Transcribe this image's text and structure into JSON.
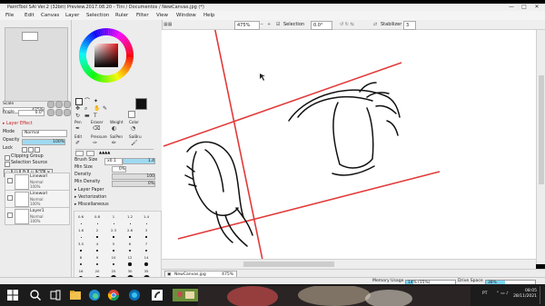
{
  "window": {
    "title": "PaintTool SAI Ver.2 (32bit) Preview.2017.08.20 - Tini / Documentos / NewCanvas.jpg (*)",
    "controls": [
      "—",
      "□",
      "✕"
    ]
  },
  "menu": [
    "File",
    "Edit",
    "Canvas",
    "Layer",
    "Selection",
    "Ruler",
    "Filter",
    "View",
    "Window",
    "Help"
  ],
  "toolbar": {
    "zoom": "475%",
    "selection_label": "Selection",
    "rotation": "0.0°",
    "stabilizer_label": "Stabilizer",
    "stabilizer_value": "3"
  },
  "navigator": {
    "scale_label": "Scale",
    "scale_value": "475%",
    "angle_label": "Angle",
    "angle_value": "0.0°"
  },
  "layer_props": {
    "section": "Layer Effect",
    "mode_label": "Mode",
    "mode_value": "Normal",
    "opacity_label": "Opacity",
    "opacity_value": "100%",
    "lock_label": "Lock",
    "clipping_group": "Clipping Group",
    "selection_source": "Selection Source"
  },
  "layers": [
    {
      "name": "Lineworl",
      "mode": "Normal",
      "opacity": "100%"
    },
    {
      "name": "Lineworl",
      "mode": "Normal",
      "opacity": "100%"
    },
    {
      "name": "Layer1",
      "mode": "Normal",
      "opacity": "100%"
    }
  ],
  "tools": {
    "row1": [
      "Pen",
      "Eraser",
      "Weight",
      "Color"
    ],
    "row2": [
      "Edit",
      "Pressure",
      "SaiPen",
      "SaiBru"
    ]
  },
  "brush": {
    "size_label": "Brush Size",
    "size_mult": "x0.1",
    "size_value": "1.4",
    "min_size_label": "Min Size",
    "min_size_value": "0%",
    "density_label": "Density",
    "density_value": "100",
    "min_density_label": "Min Density",
    "min_density_value": "0%",
    "sections": [
      "Layer Paper",
      "Vectorization",
      "Miscellaneous"
    ],
    "size_grid": [
      [
        "0.6",
        "0.8",
        "1",
        "1.2",
        "1.4"
      ],
      [
        "1.6",
        "2",
        "2.3",
        "2.6",
        "3"
      ],
      [
        "3.5",
        "4",
        "5",
        "6",
        "7"
      ],
      [
        "8",
        "9",
        "10",
        "12",
        "14"
      ],
      [
        "16",
        "20",
        "25",
        "30",
        "35"
      ]
    ]
  },
  "file_tab": {
    "name": "NewCanvas.jpg",
    "zoom": "475%"
  },
  "status": {
    "memory_label": "Memory Usage",
    "memory_value": "14% (15%)",
    "memory_fraction": 0.14,
    "drive_label": "Drive Space",
    "drive_value": "38%",
    "drive_fraction": 0.38
  },
  "taskbar": {
    "lang": "PT",
    "time": "08:05",
    "date": "28/11/2021"
  },
  "colors": {
    "guide_red": "#e23a3a",
    "ink": "#111111",
    "accent_blue": "#7fd6f2"
  }
}
